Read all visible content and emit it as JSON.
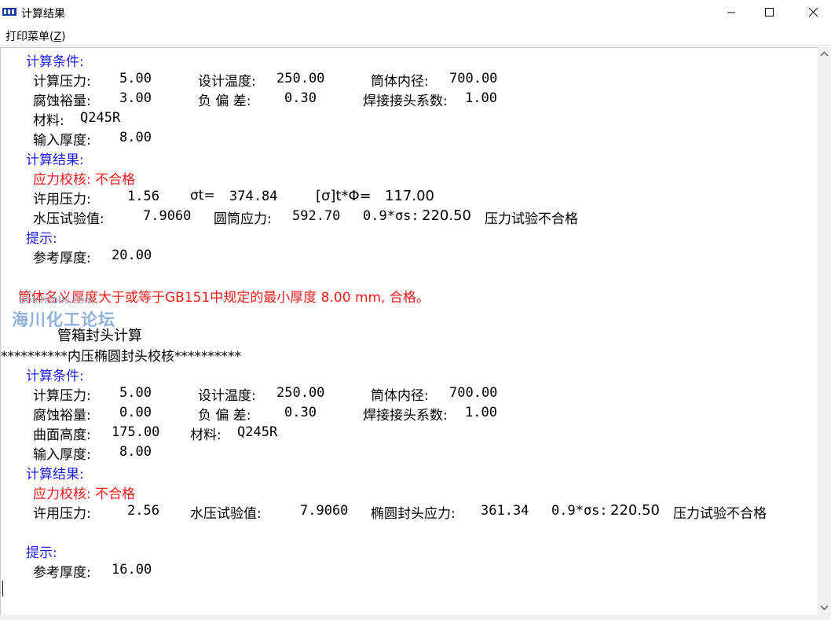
{
  "window": {
    "title": "计算结果",
    "menu_print": "打印菜单(",
    "menu_key": "Z",
    "menu_close_paren": ")"
  },
  "sec1": {
    "cond_header": "计算条件:",
    "p_label": "计算压力:",
    "p_val": "5.00",
    "t_label": "设计温度:",
    "t_val": "250.00",
    "d_label": "筒体内径:",
    "d_val": "700.00",
    "c2_label": "腐蚀裕量:",
    "c2_val": "3.00",
    "c1_label": "负 偏 差:",
    "c1_val": "0.30",
    "phi_label": "焊接接头系数:",
    "phi_val": "1.00",
    "mat_label": "材料:",
    "mat_val": "Q245R",
    "thk_label": "输入厚度:",
    "thk_val": "8.00",
    "res_header": "计算结果:",
    "stress_check": "应力校核: 不合格",
    "allow_label": "许用压力:",
    "allow_val": "1.56",
    "sigma_label": "σt=",
    "sigma_val": "374.84",
    "sigphi_label": "[σ]t*Φ=",
    "sigphi_val": "117.00",
    "hydro_label": "水压试验值:",
    "hydro_val": "7.9060",
    "cyl_label": "圆筒应力:",
    "cyl_val": "592.70",
    "ys_label": "0.9*σs:",
    "ys_val": "220.50",
    "test_result": "压力试验不合格",
    "hint_header": "提示:",
    "ref_label": "参考厚度:",
    "ref_val": "20.00",
    "min_thk_note": "筒体名义厚度大于或等于GB151中规定的最小厚度 8.00 mm, 合格。"
  },
  "watermark": {
    "site": "bbs.hcbbs.com",
    "name": "海川化工论坛"
  },
  "sec2": {
    "section_title": "管箱封头计算",
    "banner": "**********内压椭圆封头校核**********",
    "cond_header": "计算条件:",
    "p_label": "计算压力:",
    "p_val": "5.00",
    "t_label": "设计温度:",
    "t_val": "250.00",
    "d_label": "筒体内径:",
    "d_val": "700.00",
    "c2_label": "腐蚀裕量:",
    "c2_val": "0.00",
    "c1_label": "负 偏 差:",
    "c1_val": "0.30",
    "phi_label": "焊接接头系数:",
    "phi_val": "1.00",
    "h_label": "曲面高度:",
    "h_val": "175.00",
    "mat_label": "材料:",
    "mat_val": "Q245R",
    "thk_label": "输入厚度:",
    "thk_val": "8.00",
    "res_header": "计算结果:",
    "stress_check": "应力校核: 不合格",
    "allow_label": "许用压力:",
    "allow_val": "2.56",
    "hydro_label": "水压试验值:",
    "hydro_val": "7.9060",
    "head_label": "椭圆封头应力:",
    "head_val": "361.34",
    "ys_label": "0.9*σs:",
    "ys_val": "220.50",
    "test_result": "压力试验不合格",
    "hint_header": "提示:",
    "ref_label": "参考厚度:",
    "ref_val": "16.00"
  }
}
